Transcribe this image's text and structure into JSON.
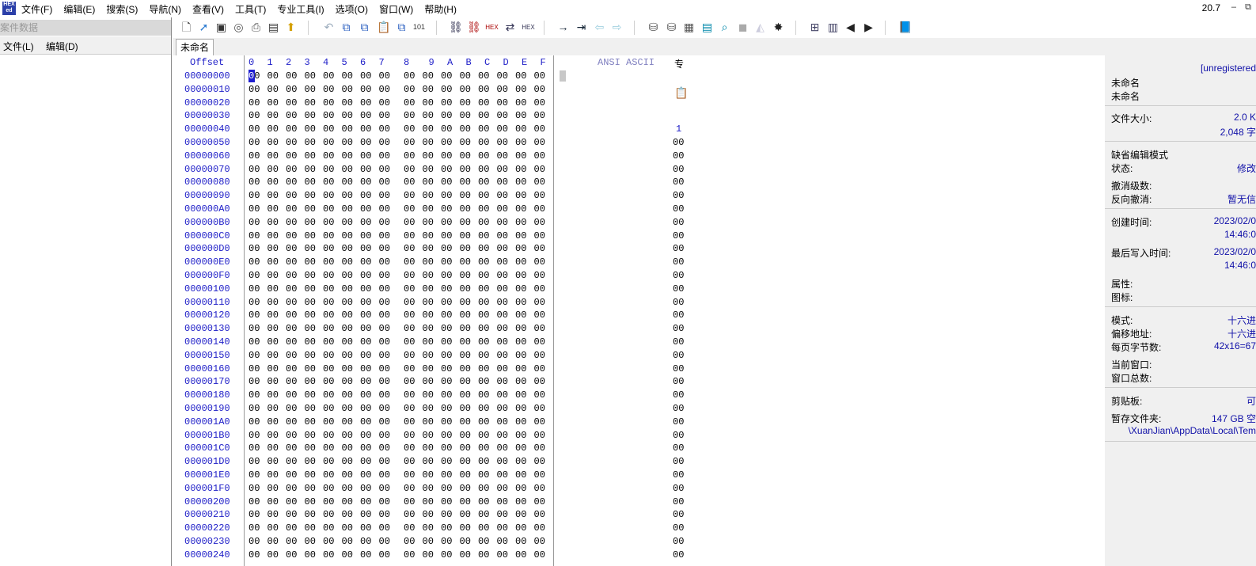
{
  "menubar": {
    "app_icon_top": "HEX",
    "app_icon_bottom": "ed",
    "items": [
      "文件(F)",
      "编辑(E)",
      "搜索(S)",
      "导航(N)",
      "查看(V)",
      "工具(T)",
      "专业工具(I)",
      "选项(O)",
      "窗口(W)",
      "帮助(H)"
    ],
    "version": "20.7",
    "minimize": "–",
    "restore": "⧉"
  },
  "left_panel": {
    "title": "案件数据",
    "menu": [
      "文件(L)",
      "编辑(D)"
    ]
  },
  "tabs": [
    "未命名"
  ],
  "hex": {
    "offset_header": "Offset",
    "columns": [
      "0",
      "1",
      "2",
      "3",
      "4",
      "5",
      "6",
      "7",
      "8",
      "9",
      "A",
      "B",
      "C",
      "D",
      "E",
      "F"
    ],
    "ansi_header": "ANSI ASCII",
    "offsets": [
      "00000000",
      "00000010",
      "00000020",
      "00000030",
      "00000040",
      "00000050",
      "00000060",
      "00000070",
      "00000080",
      "00000090",
      "000000A0",
      "000000B0",
      "000000C0",
      "000000D0",
      "000000E0",
      "000000F0",
      "00000100",
      "00000110",
      "00000120",
      "00000130",
      "00000140",
      "00000150",
      "00000160",
      "00000170",
      "00000180",
      "00000190",
      "000001A0",
      "000001B0",
      "000001C0",
      "000001D0",
      "000001E0",
      "000001F0",
      "00000200",
      "00000210",
      "00000220",
      "00000230",
      "00000240"
    ],
    "byte_value": "00",
    "cursor_char": "0"
  },
  "mini_column": {
    "header": "专",
    "index": "1",
    "byte_value": "00"
  },
  "info_panel": {
    "unregistered": "[unregistered",
    "name1": "未命名",
    "name2": "未命名",
    "file_size_label": "文件大小:",
    "file_size_kb": "2.0 K",
    "file_size_bytes": "2,048 字",
    "default_edit_mode": "缺省编辑模式",
    "state_label": "状态:",
    "state_value": "修改",
    "undo_level_label": "撤消级数:",
    "reverse_undo_label": "反向撤消:",
    "reverse_undo_value": "暂无信",
    "created_label": "创建时间:",
    "created_date": "2023/02/0",
    "created_time": "14:46:0",
    "last_write_label": "最后写入时间:",
    "last_write_date": "2023/02/0",
    "last_write_time": "14:46:0",
    "attributes_label": "属性:",
    "icon_label": "图标:",
    "mode_label": "模式:",
    "mode_value": "十六进",
    "offset_addr_label": "偏移地址:",
    "offset_addr_value": "十六进",
    "bytes_per_page_label": "每页字节数:",
    "bytes_per_page_value": "42x16=67",
    "current_window_label": "当前窗口:",
    "total_windows_label": "窗口总数:",
    "clipboard_label": "剪贴板:",
    "clipboard_value": "可",
    "temp_folder_label": "暂存文件夹:",
    "temp_folder_value": "147 GB 空",
    "temp_path": "\\XuanJian\\AppData\\Local\\Tem"
  }
}
